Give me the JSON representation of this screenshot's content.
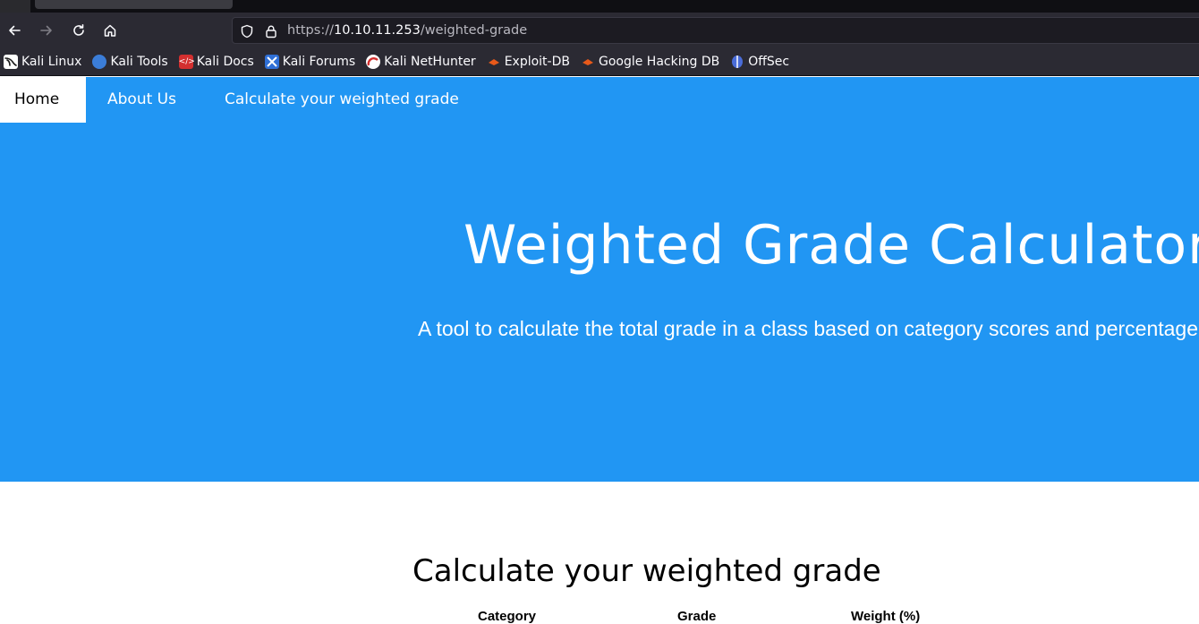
{
  "browser": {
    "url_prefix": "https://",
    "url_host": "10.10.11.253",
    "url_path": "/weighted-grade",
    "bookmarks": [
      {
        "label": "Kali Linux",
        "icon": "kali-dragon-icon",
        "color": "#1a1a1a"
      },
      {
        "label": "Kali Tools",
        "icon": "kali-tools-icon",
        "color": "#3b7dd8"
      },
      {
        "label": "Kali Docs",
        "icon": "kali-docs-icon",
        "color": "#d32f2f"
      },
      {
        "label": "Kali Forums",
        "icon": "kali-forums-icon",
        "color": "#2f6fd6"
      },
      {
        "label": "Kali NetHunter",
        "icon": "kali-nethunter-icon",
        "color": "#d32f2f"
      },
      {
        "label": "Exploit-DB",
        "icon": "exploit-db-icon",
        "color": "#e8591a"
      },
      {
        "label": "Google Hacking DB",
        "icon": "ghdb-icon",
        "color": "#e8591a"
      },
      {
        "label": "OffSec",
        "icon": "offsec-icon",
        "color": "#4a6cd8"
      }
    ]
  },
  "site_nav": {
    "items": [
      {
        "label": "Home",
        "active": true
      },
      {
        "label": "About Us",
        "active": false
      },
      {
        "label": "Calculate your weighted grade",
        "active": false
      }
    ]
  },
  "hero": {
    "title": "Weighted Grade Calculator",
    "subtitle": "A tool to calculate the total grade in a class based on category scores and percentage weights."
  },
  "calculator": {
    "title": "Calculate your weighted grade",
    "columns": [
      "Category",
      "Grade",
      "Weight (%)"
    ]
  },
  "colors": {
    "primary": "#2196f3",
    "chrome_bg": "#2b2a33",
    "url_bg": "#1c1b22"
  }
}
